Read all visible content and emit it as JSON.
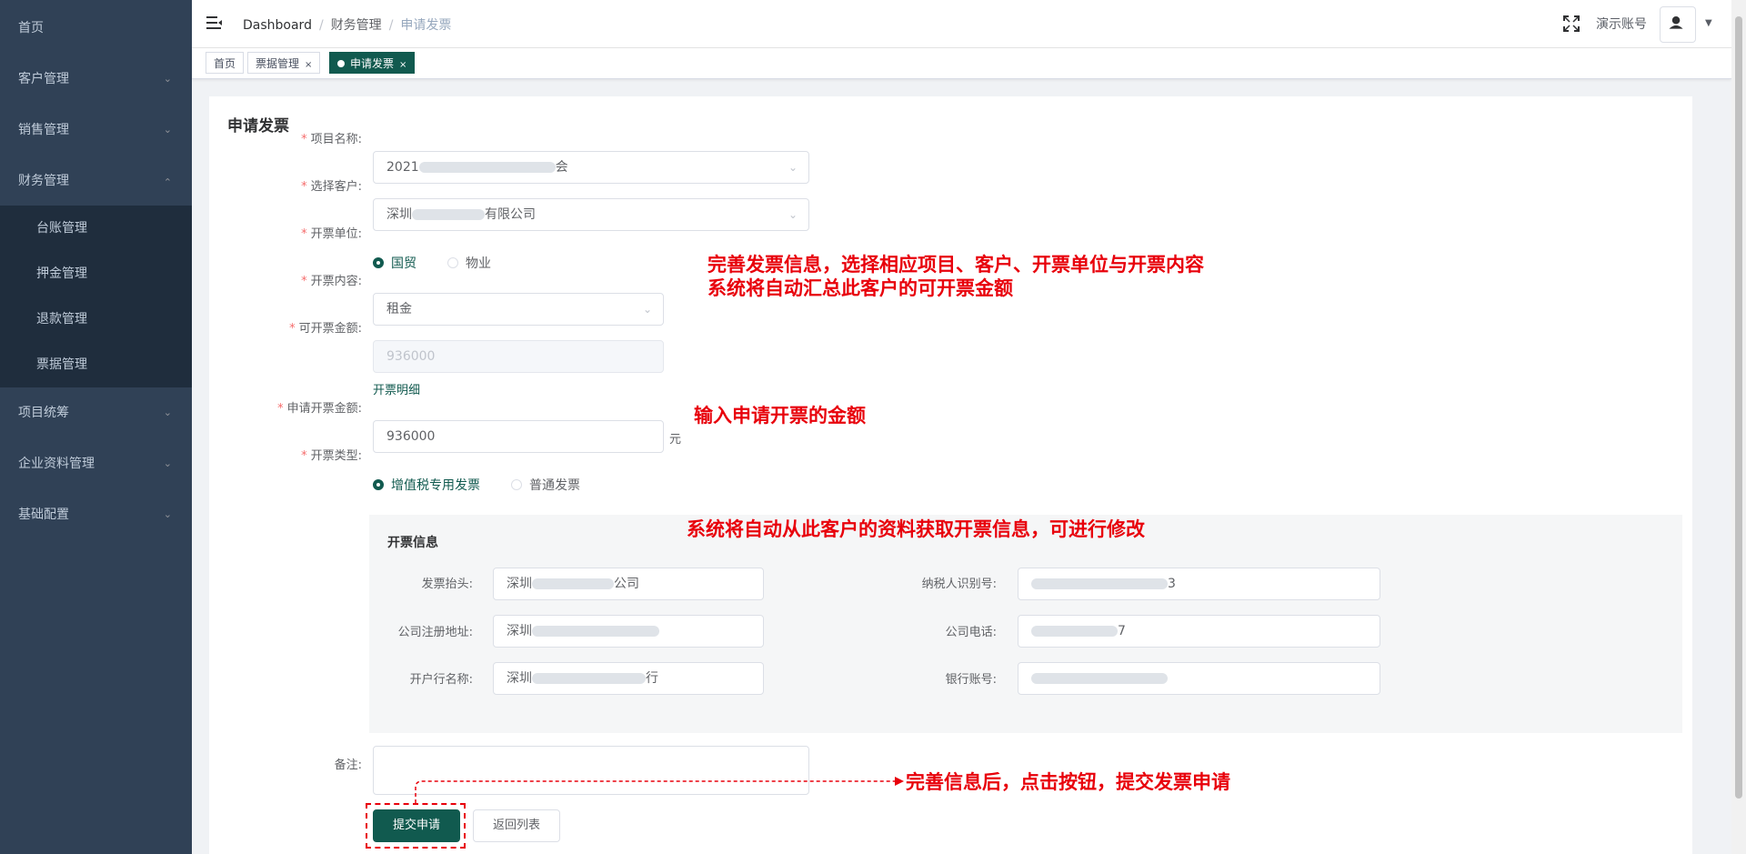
{
  "sidebar": {
    "items": [
      {
        "label": "首页",
        "has_arrow": false
      },
      {
        "label": "客户管理",
        "has_arrow": true
      },
      {
        "label": "销售管理",
        "has_arrow": true
      },
      {
        "label": "财务管理",
        "has_arrow": true,
        "expanded": true
      },
      {
        "label": "项目统筹",
        "has_arrow": true
      },
      {
        "label": "企业资料管理",
        "has_arrow": true
      },
      {
        "label": "基础配置",
        "has_arrow": true
      }
    ],
    "finance_sub": [
      "台账管理",
      "押金管理",
      "退款管理",
      "票据管理"
    ]
  },
  "header": {
    "breadcrumb": [
      "Dashboard",
      "财务管理",
      "申请发票"
    ],
    "account_name": "演示账号"
  },
  "tags": [
    {
      "label": "首页",
      "active": false,
      "closable": false
    },
    {
      "label": "票据管理",
      "active": false,
      "closable": true
    },
    {
      "label": "申请发票",
      "active": true,
      "closable": true
    }
  ],
  "form": {
    "title": "申请发票",
    "project_label": "项目名称:",
    "project_value_prefix": "2021",
    "project_value_suffix": "会",
    "customer_label": "选择客户:",
    "customer_value_prefix": "深圳",
    "customer_value_suffix": "有限公司",
    "unit_label": "开票单位:",
    "unit_options": [
      "国贸",
      "物业"
    ],
    "unit_selected": "国贸",
    "content_label": "开票内容:",
    "content_value": "租金",
    "available_label": "可开票金额:",
    "available_value": "936000",
    "detail_link": "开票明细",
    "apply_label": "申请开票金额:",
    "apply_value": "936000",
    "apply_unit": "元",
    "type_label": "开票类型:",
    "type_options": [
      "增值税专用发票",
      "普通发票"
    ],
    "type_selected": "增值税专用发票",
    "remark_label": "备注:",
    "submit_label": "提交申请",
    "back_label": "返回列表"
  },
  "invoice_info": {
    "title": "开票信息",
    "header_label": "发票抬头:",
    "header_prefix": "深圳",
    "header_suffix": "公司",
    "tax_label": "纳税人识别号:",
    "tax_suffix": "3",
    "address_label": "公司注册地址:",
    "address_prefix": "深圳",
    "phone_label": "公司电话:",
    "phone_suffix": "7",
    "bank_label": "开户行名称:",
    "bank_prefix": "深圳",
    "bank_suffix": "行",
    "account_label": "银行账号:"
  },
  "annotations": {
    "line1": "完善发票信息，选择相应项目、客户、开票单位与开票内容",
    "line2": "系统将自动汇总此客户的可开票金额",
    "amount": "输入申请开票的金额",
    "info": "系统将自动从此客户的资料获取开票信息，可进行修改",
    "submit": "完善信息后，点击按钮，提交发票申请"
  },
  "colors": {
    "sidebar_bg": "#304156",
    "submenu_bg": "#1f2d3d",
    "primary": "#115a4f",
    "annotation_red": "#e8000b"
  }
}
